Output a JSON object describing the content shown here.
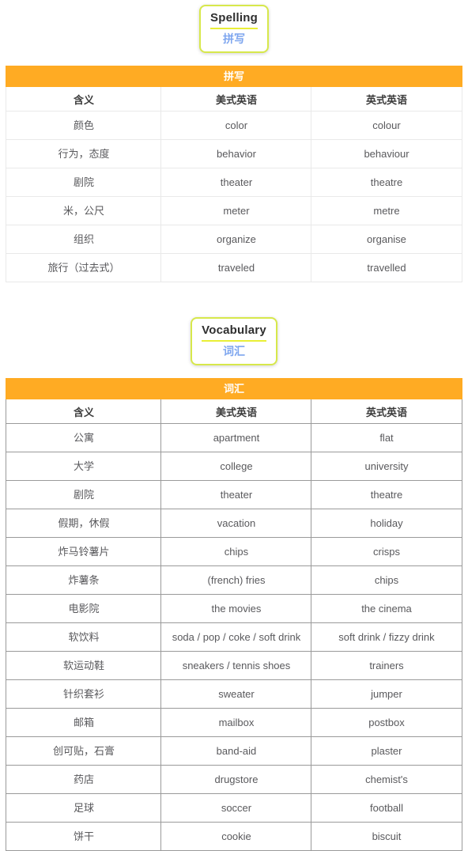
{
  "theme": {
    "accent_orange": "#ffab23",
    "badge_border": "#d7e84b",
    "badge_rule": "#e9ef36",
    "badge_zh_color": "#7ea6ef"
  },
  "sections": [
    {
      "badge": {
        "english": "Spelling",
        "chinese": "拼写"
      },
      "table": {
        "title": "拼写",
        "columns": [
          "含义",
          "美式英语",
          "英式英语"
        ],
        "rows": [
          [
            "颜色",
            "color",
            "colour"
          ],
          [
            "行为，态度",
            "behavior",
            "behaviour"
          ],
          [
            "剧院",
            "theater",
            "theatre"
          ],
          [
            "米，公尺",
            "meter",
            "metre"
          ],
          [
            "组织",
            "organize",
            "organise"
          ],
          [
            "旅行（过去式）",
            "traveled",
            "travelled"
          ]
        ]
      }
    },
    {
      "badge": {
        "english": "Vocabulary",
        "chinese": "词汇"
      },
      "table": {
        "title": "词汇",
        "columns": [
          "含义",
          "美式英语",
          "英式英语"
        ],
        "rows": [
          [
            "公寓",
            "apartment",
            "flat"
          ],
          [
            "大学",
            "college",
            "university"
          ],
          [
            "剧院",
            "theater",
            "theatre"
          ],
          [
            "假期，休假",
            "vacation",
            "holiday"
          ],
          [
            "炸马铃薯片",
            "chips",
            "crisps"
          ],
          [
            "炸薯条",
            "(french) fries",
            "chips"
          ],
          [
            "电影院",
            "the movies",
            "the cinema"
          ],
          [
            "软饮料",
            "soda / pop / coke / soft drink",
            "soft drink / fizzy drink"
          ],
          [
            "软运动鞋",
            "sneakers / tennis shoes",
            "trainers"
          ],
          [
            "针织套衫",
            "sweater",
            "jumper"
          ],
          [
            "邮箱",
            "mailbox",
            "postbox"
          ],
          [
            "创可贴，石膏",
            "band-aid",
            "plaster"
          ],
          [
            "药店",
            "drugstore",
            "chemist's"
          ],
          [
            "足球",
            "soccer",
            "football"
          ],
          [
            "饼干",
            "cookie",
            "biscuit"
          ]
        ]
      }
    }
  ]
}
